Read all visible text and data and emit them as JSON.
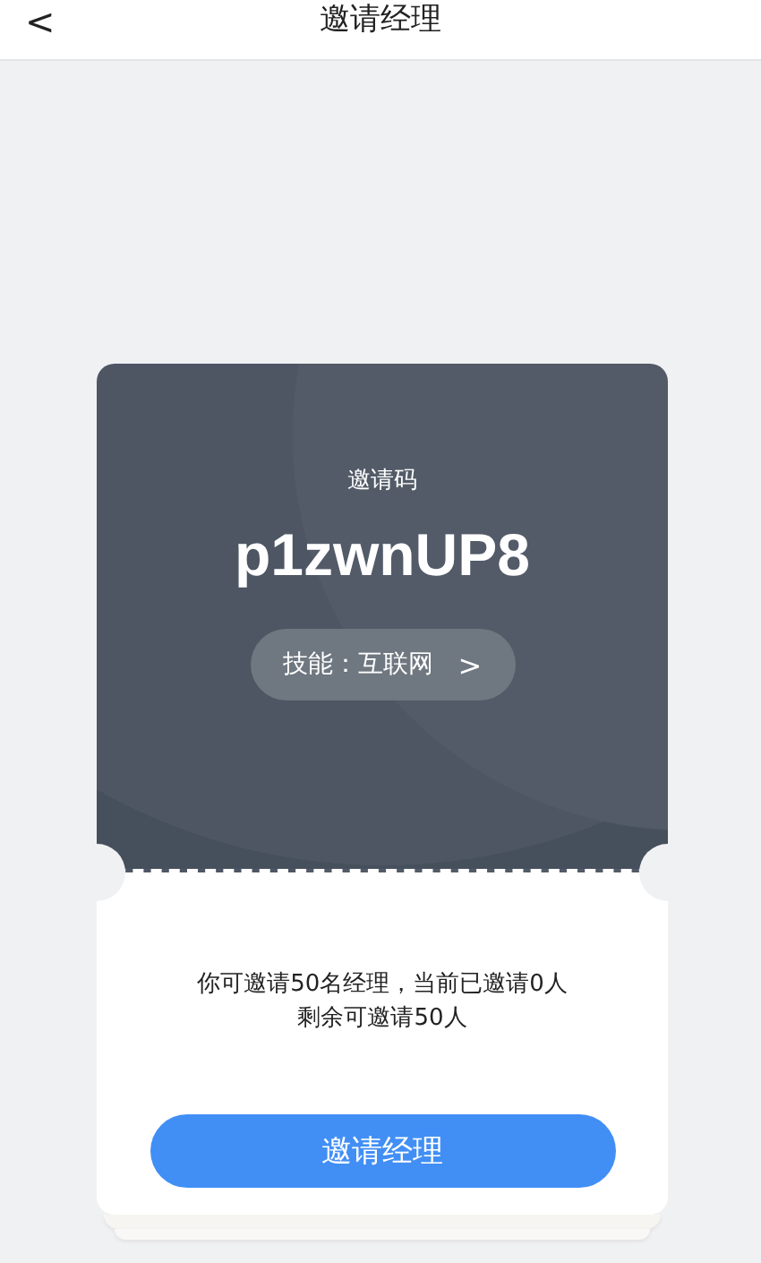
{
  "header": {
    "back": "<",
    "title": "邀请经理"
  },
  "card": {
    "code_label": "邀请码",
    "code": "p1zwnUP8",
    "skill": "技能：互联网",
    "skill_arrow": ">"
  },
  "info": {
    "lines": [
      "你可邀请50名经理，当前已邀请0人",
      "剩余可邀请50人"
    ]
  },
  "action_button": "邀请经理"
}
